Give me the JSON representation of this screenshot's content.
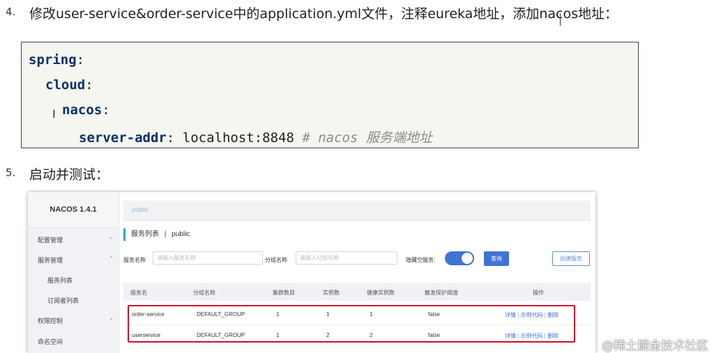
{
  "step4": {
    "number": "4.",
    "text": "修改user-service&order-service中的application.yml文件，注释eureka地址，添加nacos地址："
  },
  "code": {
    "line1_key": "spring",
    "line1_colon": ":",
    "line2_key": "cloud",
    "line2_colon": ":",
    "line3_key": "nacos",
    "line3_colon": ":",
    "line4_key": "server-addr",
    "line4_colon": ":",
    "line4_value": "localhost:8848",
    "line4_comment": "# nacos 服务端地址"
  },
  "step5": {
    "number": "5.",
    "text": "启动并测试："
  },
  "console": {
    "brand": "NACOS 1.4.1",
    "sidebar": [
      {
        "label": "配置管理",
        "chevron": "⌄"
      },
      {
        "label": "服务管理",
        "chevron": "⌃"
      },
      {
        "label": "服务列表"
      },
      {
        "label": "订阅者列表"
      },
      {
        "label": "权限控制",
        "chevron": "⌄"
      },
      {
        "label": "命名空间"
      }
    ],
    "namespace_tab": "public",
    "page_title": "服务列表",
    "page_sep": "|",
    "page_ns": "public",
    "filters": {
      "service_label": "服务名称",
      "service_placeholder": "请输入服务名称",
      "group_label": "分组名称",
      "group_placeholder": "请输入分组名称",
      "hide_empty_label": "隐藏空服务:",
      "query_button": "查询",
      "create_button": "创建服务"
    },
    "table": {
      "headers": [
        "服务名",
        "分组名称",
        "集群数目",
        "实例数",
        "健康实例数",
        "触发保护阈值",
        "操作"
      ],
      "rows": [
        {
          "name": "order-service",
          "group": "DEFAULT_GROUP",
          "clusters": "1",
          "instances": "1",
          "healthy": "1",
          "threshold": "false"
        },
        {
          "name": "userservice",
          "group": "DEFAULT_GROUP",
          "clusters": "1",
          "instances": "2",
          "healthy": "2",
          "threshold": "false"
        }
      ],
      "op_detail": "详情",
      "op_sep": "|",
      "op_sample": "示例代码",
      "op_delete": "删除"
    }
  },
  "watermark": "@稀土掘金技术社区",
  "colors": {
    "accent_blue": "#3e74d6",
    "highlight_red": "#c8102e",
    "code_bg": "#f4f6ef"
  }
}
